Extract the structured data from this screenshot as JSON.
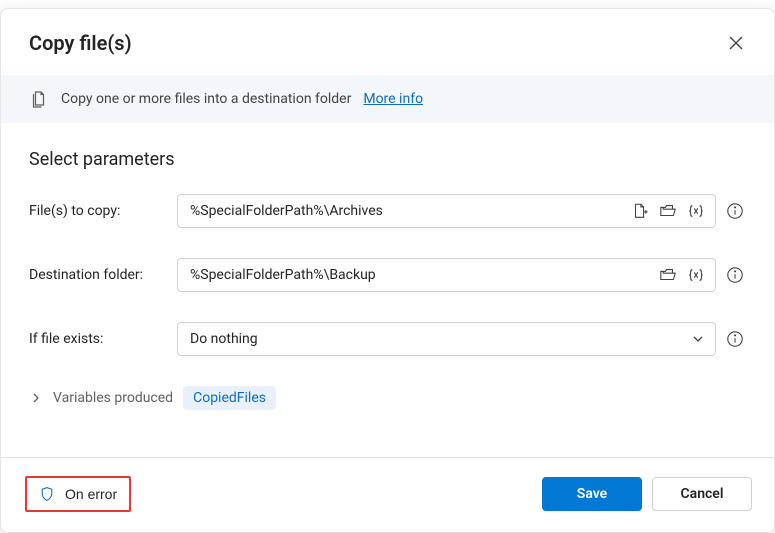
{
  "dialog": {
    "title": "Copy file(s)"
  },
  "info": {
    "description": "Copy one or more files into a destination folder",
    "more_info_label": "More info"
  },
  "section": {
    "title": "Select parameters"
  },
  "fields": {
    "files_to_copy": {
      "label": "File(s) to copy:",
      "value": "%SpecialFolderPath%\\Archives"
    },
    "destination_folder": {
      "label": "Destination folder:",
      "value": "%SpecialFolderPath%\\Backup"
    },
    "if_file_exists": {
      "label": "If file exists:",
      "selected": "Do nothing"
    }
  },
  "variables_produced": {
    "label": "Variables produced",
    "chips": [
      "CopiedFiles"
    ]
  },
  "footer": {
    "on_error_label": "On error",
    "save_label": "Save",
    "cancel_label": "Cancel"
  }
}
